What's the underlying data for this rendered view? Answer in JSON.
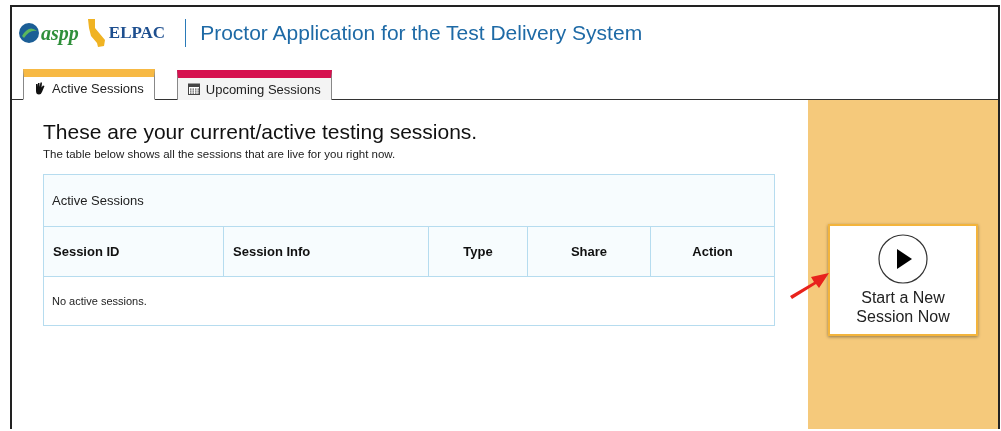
{
  "header": {
    "logo_1": "aspp",
    "logo_2": "ELPAC",
    "title": "Proctor Application for the Test Delivery System"
  },
  "tabs": [
    {
      "label": "Active Sessions",
      "selected": true,
      "color": "#f7b944",
      "kind": "hand"
    },
    {
      "label": "Upcoming Sessions",
      "selected": false,
      "color": "#d6114f",
      "kind": "calendar"
    }
  ],
  "main": {
    "heading": "These are your current/active testing sessions.",
    "subheading": "The table below shows all the sessions that are live for you right now."
  },
  "table": {
    "caption": "Active Sessions",
    "columns": [
      "Session ID",
      "Session Info",
      "Type",
      "Share",
      "Action"
    ],
    "empty_message": "No active sessions."
  },
  "side_panel": {
    "start_button": "Start a New Session Now"
  }
}
